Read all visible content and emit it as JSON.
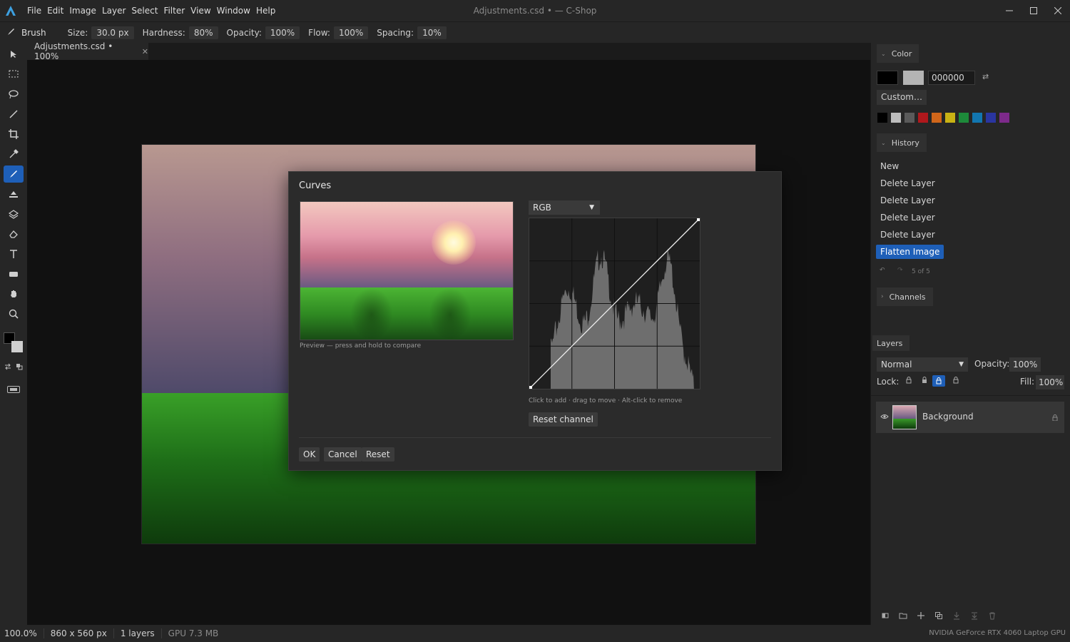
{
  "app": {
    "window_title": "Adjustments.csd • — C-Shop",
    "menu": [
      "File",
      "Edit",
      "Image",
      "Layer",
      "Select",
      "Filter",
      "View",
      "Window",
      "Help"
    ],
    "window_controls": [
      "minimize-icon",
      "maximize-icon",
      "close-icon"
    ]
  },
  "options_bar": {
    "tool_name": "Brush",
    "size_label": "Size:",
    "size_value": "30.0 px",
    "hardness_label": "Hardness:",
    "hardness_value": "80%",
    "opacity_label": "Opacity:",
    "opacity_value": "100%",
    "flow_label": "Flow:",
    "flow_value": "100%",
    "spacing_label": "Spacing:",
    "spacing_value": "10%"
  },
  "tools": [
    "move-tool",
    "marquee-tool",
    "lasso-tool",
    "magic-wand-tool",
    "crop-tool",
    "eyedropper-tool",
    "brush-tool",
    "fill-tool",
    "layers-tool",
    "eraser-tool",
    "text-tool",
    "shape-tool",
    "hand-tool",
    "zoom-tool"
  ],
  "active_tool": "brush-tool",
  "document_tab": {
    "label": "Adjustments.csd • 100%"
  },
  "color_panel": {
    "title": "Color",
    "hex_value": "000000",
    "custom_button": "Custom…",
    "foreground": "#000000",
    "background": "#b4b4b4",
    "swatches": [
      "#000000",
      "#bdbdbd",
      "#5a5a5a",
      "#b0181c",
      "#d0661a",
      "#c9b214",
      "#1d8a3a",
      "#1276b0",
      "#2a35a0",
      "#7d2a8a"
    ]
  },
  "history_panel": {
    "title": "History",
    "items": [
      "New",
      "Delete Layer",
      "Delete Layer",
      "Delete Layer",
      "Delete Layer",
      "Flatten Image"
    ],
    "selected_index": 5,
    "counter": "5 of 5"
  },
  "channels_panel": {
    "title": "Channels"
  },
  "layers_panel": {
    "title": "Layers",
    "blend_mode": "Normal",
    "opacity_label": "Opacity:",
    "opacity_value": "100%",
    "lock_label": "Lock:",
    "fill_label": "Fill:",
    "fill_value": "100%",
    "layers": [
      {
        "name": "Background",
        "visible": true,
        "locked": true
      }
    ]
  },
  "status_bar": {
    "zoom": "100.0%",
    "dimensions": "860 x 560 px",
    "layers": "1 layers",
    "gpu_memory": "GPU 7.3 MB",
    "gpu_name": "NVIDIA GeForce RTX 4060 Laptop GPU"
  },
  "curves_dialog": {
    "title": "Curves",
    "preview_caption": "Preview — press and hold to compare",
    "channel": "RGB",
    "hint": "Click to add · drag to move · Alt-click to remove",
    "reset_channel_button": "Reset channel",
    "ok_button": "OK",
    "cancel_button": "Cancel",
    "reset_button": "Reset",
    "curve_points": [
      [
        0,
        0
      ],
      [
        255,
        255
      ]
    ]
  },
  "colors": {
    "accent": "#1e5fb8",
    "panel_bg": "#262626",
    "canvas_bg": "#111111"
  }
}
